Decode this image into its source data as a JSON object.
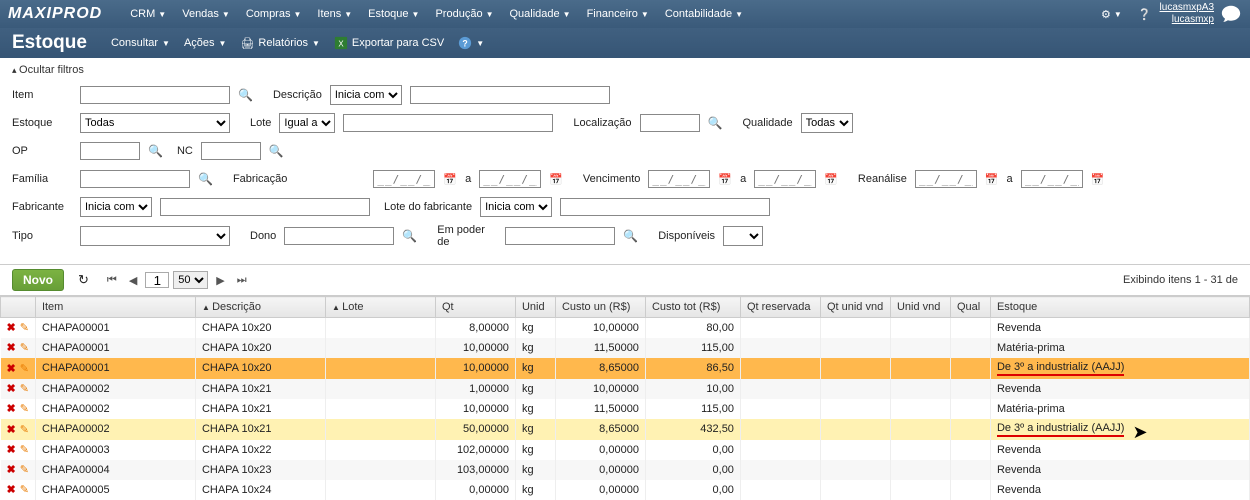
{
  "brand": "MAXIPROD",
  "topmenu": [
    "CRM",
    "Vendas",
    "Compras",
    "Itens",
    "Estoque",
    "Produção",
    "Qualidade",
    "Financeiro",
    "Contabilidade"
  ],
  "user": {
    "line1": "lucasmxpA3",
    "line2": "lucasmxp"
  },
  "page": {
    "title": "Estoque",
    "menu": {
      "consultar": "Consultar",
      "acoes": "Ações",
      "relatorios": "Relatórios",
      "exportar": "Exportar para CSV"
    }
  },
  "filters": {
    "toggle": "Ocultar filtros",
    "labels": {
      "item": "Item",
      "descricao": "Descrição",
      "estoque": "Estoque",
      "lote": "Lote",
      "localizacao": "Localização",
      "qualidade": "Qualidade",
      "op": "OP",
      "nc": "NC",
      "familia": "Família",
      "fabricacao": "Fabricação",
      "vencimento": "Vencimento",
      "reanalise": "Reanálise",
      "fabricante": "Fabricante",
      "lote_fabricante": "Lote do fabricante",
      "tipo": "Tipo",
      "dono": "Dono",
      "em_poder": "Em poder de",
      "disponiveis": "Disponíveis",
      "a": "a"
    },
    "selects": {
      "descricao_mode": "Inicia com",
      "estoque": "Todas",
      "lote_mode": "Igual a",
      "qualidade": "Todas",
      "fabricante_mode": "Inicia com",
      "lote_fab_mode": "Inicia com"
    },
    "date_placeholder": "__/__/__"
  },
  "actions": {
    "novo": "Novo"
  },
  "pager": {
    "page": "1",
    "size": "50"
  },
  "showing": "Exibindo itens 1 - 31 de",
  "columns": {
    "item": "Item",
    "descricao": "Descrição",
    "lote": "Lote",
    "qt": "Qt",
    "unid": "Unid",
    "custo_un": "Custo un (R$)",
    "custo_tot": "Custo tot (R$)",
    "qt_reservada": "Qt reservada",
    "qt_unid_vnd": "Qt unid vnd",
    "unid_vnd": "Unid vnd",
    "qual": "Qual",
    "estoque": "Estoque"
  },
  "rows": [
    {
      "item": "CHAPA00001",
      "desc": "CHAPA 10x20",
      "lote": "",
      "qt": "8,00000",
      "unid": "kg",
      "cun": "10,00000",
      "ctot": "80,00",
      "qr": "",
      "estoque": "Revenda",
      "hl": ""
    },
    {
      "item": "CHAPA00001",
      "desc": "CHAPA 10x20",
      "lote": "",
      "qt": "10,00000",
      "unid": "kg",
      "cun": "11,50000",
      "ctot": "115,00",
      "qr": "",
      "estoque": "Matéria-prima",
      "hl": ""
    },
    {
      "item": "CHAPA00001",
      "desc": "CHAPA 10x20",
      "lote": "",
      "qt": "10,00000",
      "unid": "kg",
      "cun": "8,65000",
      "ctot": "86,50",
      "qr": "",
      "estoque": "De 3º a industrializ (AAJJ)",
      "hl": "orange",
      "ul": true
    },
    {
      "item": "CHAPA00002",
      "desc": "CHAPA 10x21",
      "lote": "",
      "qt": "1,00000",
      "unid": "kg",
      "cun": "10,00000",
      "ctot": "10,00",
      "qr": "",
      "estoque": "Revenda",
      "hl": ""
    },
    {
      "item": "CHAPA00002",
      "desc": "CHAPA 10x21",
      "lote": "",
      "qt": "10,00000",
      "unid": "kg",
      "cun": "11,50000",
      "ctot": "115,00",
      "qr": "",
      "estoque": "Matéria-prima",
      "hl": ""
    },
    {
      "item": "CHAPA00002",
      "desc": "CHAPA 10x21",
      "lote": "",
      "qt": "50,00000",
      "unid": "kg",
      "cun": "8,65000",
      "ctot": "432,50",
      "qr": "",
      "estoque": "De 3º a industrializ (AAJJ)",
      "hl": "yellow",
      "ul": true,
      "cursor": true
    },
    {
      "item": "CHAPA00003",
      "desc": "CHAPA 10x22",
      "lote": "",
      "qt": "102,00000",
      "unid": "kg",
      "cun": "0,00000",
      "ctot": "0,00",
      "qr": "",
      "estoque": "Revenda",
      "hl": ""
    },
    {
      "item": "CHAPA00004",
      "desc": "CHAPA 10x23",
      "lote": "",
      "qt": "103,00000",
      "unid": "kg",
      "cun": "0,00000",
      "ctot": "0,00",
      "qr": "",
      "estoque": "Revenda",
      "hl": ""
    },
    {
      "item": "CHAPA00005",
      "desc": "CHAPA 10x24",
      "lote": "",
      "qt": "0,00000",
      "unid": "kg",
      "cun": "0,00000",
      "ctot": "0,00",
      "qr": "",
      "estoque": "Revenda",
      "hl": ""
    }
  ]
}
